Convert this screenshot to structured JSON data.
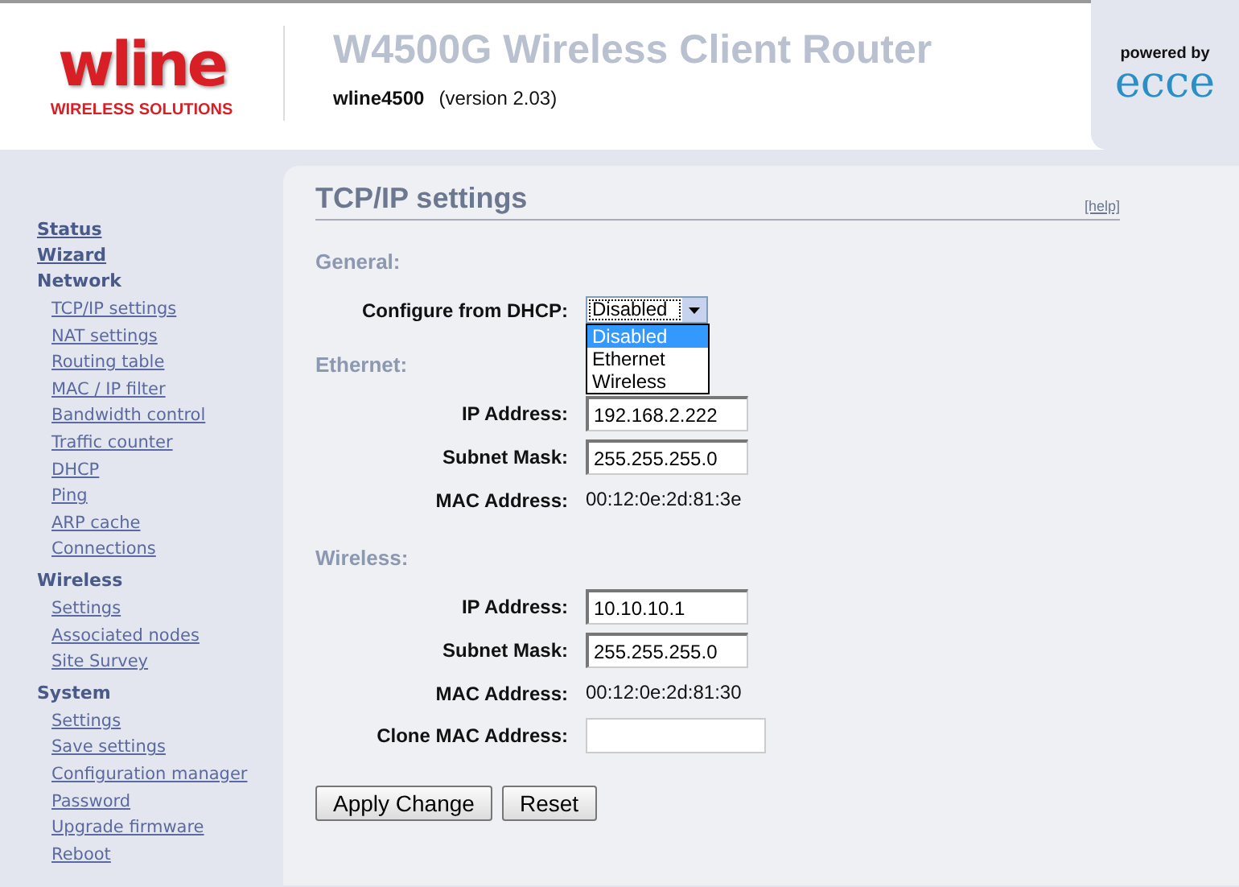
{
  "header": {
    "logo": {
      "name": "wline",
      "tagline": "WIRELESS SOLUTIONS"
    },
    "title": "W4500G Wireless Client Router",
    "device": "wline4500",
    "version": "(version 2.03)",
    "powered_by": {
      "label": "powered by",
      "brand": "ecce"
    }
  },
  "sidebar": {
    "items": [
      {
        "label": "Status",
        "kind": "link"
      },
      {
        "label": "Wizard",
        "kind": "link"
      },
      {
        "label": "Network",
        "kind": "group",
        "children": [
          {
            "label": "TCP/IP settings"
          },
          {
            "label": "NAT settings"
          },
          {
            "label": "Routing table"
          },
          {
            "label": "MAC / IP filter"
          },
          {
            "label": "Bandwidth control"
          },
          {
            "label": "Traffic counter"
          },
          {
            "label": "DHCP"
          },
          {
            "label": "Ping"
          },
          {
            "label": "ARP cache"
          },
          {
            "label": "Connections"
          }
        ]
      },
      {
        "label": "Wireless",
        "kind": "group",
        "children": [
          {
            "label": "Settings"
          },
          {
            "label": "Associated nodes"
          },
          {
            "label": "Site Survey"
          }
        ]
      },
      {
        "label": "System",
        "kind": "group",
        "children": [
          {
            "label": "Settings"
          },
          {
            "label": "Save settings"
          },
          {
            "label": "Configuration manager"
          },
          {
            "label": "Password"
          },
          {
            "label": "Upgrade firmware"
          },
          {
            "label": "Reboot"
          }
        ]
      }
    ]
  },
  "content": {
    "title": "TCP/IP settings",
    "help": "[help]",
    "sections": [
      {
        "heading": "General:",
        "rows": [
          {
            "kind": "select",
            "label": "Configure from DHCP:",
            "value": "Disabled",
            "expanded": true,
            "options": [
              {
                "label": "Disabled",
                "selected": true
              },
              {
                "label": "Ethernet",
                "selected": false
              },
              {
                "label": "Wireless",
                "selected": false
              }
            ]
          }
        ]
      },
      {
        "heading": "Ethernet:",
        "rows": [
          {
            "kind": "input",
            "label": "IP Address:",
            "value": "192.168.2.222"
          },
          {
            "kind": "input",
            "label": "Subnet Mask:",
            "value": "255.255.255.0"
          },
          {
            "kind": "text",
            "label": "MAC Address:",
            "value": "00:12:0e:2d:81:3e"
          }
        ]
      },
      {
        "heading": "Wireless:",
        "rows": [
          {
            "kind": "input",
            "label": "IP Address:",
            "value": "10.10.10.1"
          },
          {
            "kind": "input",
            "label": "Subnet Mask:",
            "value": "255.255.255.0"
          },
          {
            "kind": "text",
            "label": "MAC Address:",
            "value": "00:12:0e:2d:81:30"
          },
          {
            "kind": "plain-input",
            "label": "Clone MAC Address:",
            "value": ""
          }
        ]
      }
    ],
    "buttons": [
      "Apply Change",
      "Reset"
    ]
  }
}
